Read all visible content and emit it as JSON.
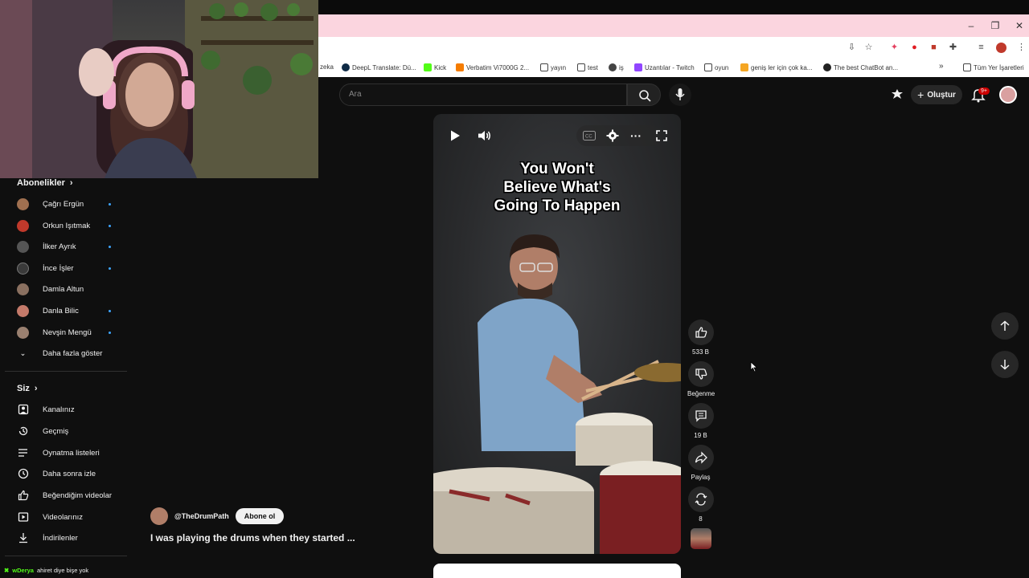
{
  "browser": {
    "window_controls": [
      "–",
      "❐",
      "✕"
    ],
    "bookmarks": [
      {
        "label": "zeka",
        "color": "#ffffff"
      },
      {
        "label": "DeepL Translate: Dü...",
        "color": "#0f2b46"
      },
      {
        "label": "Kick",
        "color": "#53fc18"
      },
      {
        "label": "Verbatim Vi7000G 2...",
        "color": "#f57c00"
      },
      {
        "label": "yayın",
        "color": "#ffffff"
      },
      {
        "label": "test",
        "color": "#ffffff"
      },
      {
        "label": "iş",
        "color": "#444444"
      },
      {
        "label": "Uzantılar - Twitch",
        "color": "#9146ff"
      },
      {
        "label": "oyun",
        "color": "#ffffff"
      },
      {
        "label": "geniş ler için çok ka...",
        "color": "#f5a623"
      },
      {
        "label": "The best ChatBot an...",
        "color": "#222222"
      }
    ],
    "bookmarks_overflow": "»",
    "all_bookmarks": "Tüm Yer İşaretleri"
  },
  "youtube": {
    "search_placeholder": "Ara",
    "create_label": "Oluştur",
    "notification_badge": "9+"
  },
  "sidebar": {
    "subscriptions_heading": "Abonelikler",
    "subscriptions": [
      {
        "name": "Çağrı Ergün",
        "color": "#a07050",
        "new": true
      },
      {
        "name": "Orkun Işıtmak",
        "color": "#c0392b",
        "new": true
      },
      {
        "name": "İlker Ayrık",
        "color": "#555555",
        "new": true
      },
      {
        "name": "İnce İşler",
        "color": "#3a3a3a",
        "new": true
      },
      {
        "name": "Damla Altun",
        "color": "#8a7060",
        "new": false
      },
      {
        "name": "Danla Bilic",
        "color": "#c47a6a",
        "new": true
      },
      {
        "name": "Nevşin Mengü",
        "color": "#9a8070",
        "new": true
      }
    ],
    "show_more": "Daha fazla göster",
    "you_heading": "Siz",
    "you_items": [
      {
        "label": "Kanalınız",
        "icon": "user-square-icon"
      },
      {
        "label": "Geçmiş",
        "icon": "history-icon"
      },
      {
        "label": "Oynatma listeleri",
        "icon": "playlist-icon"
      },
      {
        "label": "Daha sonra izle",
        "icon": "clock-icon"
      },
      {
        "label": "Beğendiğim videolar",
        "icon": "thumbs-up-icon"
      },
      {
        "label": "Videolarınız",
        "icon": "video-icon"
      },
      {
        "label": "İndirilenler",
        "icon": "download-icon"
      }
    ]
  },
  "chat": {
    "user": "wDerya",
    "message": "ahiret diye bişe yok"
  },
  "short": {
    "overlay_text_line1": "You Won't",
    "overlay_text_line2": "Believe What's",
    "overlay_text_line3": "Going To Happen",
    "channel": "@TheDrumPath",
    "subscribe_label": "Abone ol",
    "title": "I was playing the drums when they started ...",
    "likes": "533 B",
    "dislike_label": "Beğenme",
    "comments": "19 B",
    "share_label": "Paylaş",
    "remix_count": "8"
  }
}
